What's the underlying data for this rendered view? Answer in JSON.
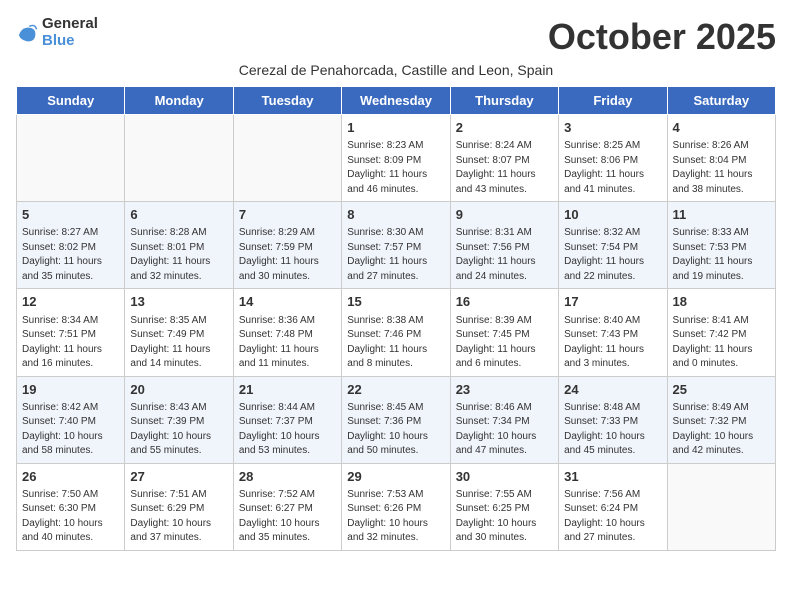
{
  "logo": {
    "general": "General",
    "blue": "Blue"
  },
  "title": "October 2025",
  "subtitle": "Cerezal de Penahorcada, Castille and Leon, Spain",
  "days_of_week": [
    "Sunday",
    "Monday",
    "Tuesday",
    "Wednesday",
    "Thursday",
    "Friday",
    "Saturday"
  ],
  "weeks": [
    [
      {
        "day": "",
        "info": ""
      },
      {
        "day": "",
        "info": ""
      },
      {
        "day": "",
        "info": ""
      },
      {
        "day": "1",
        "info": "Sunrise: 8:23 AM\nSunset: 8:09 PM\nDaylight: 11 hours and 46 minutes."
      },
      {
        "day": "2",
        "info": "Sunrise: 8:24 AM\nSunset: 8:07 PM\nDaylight: 11 hours and 43 minutes."
      },
      {
        "day": "3",
        "info": "Sunrise: 8:25 AM\nSunset: 8:06 PM\nDaylight: 11 hours and 41 minutes."
      },
      {
        "day": "4",
        "info": "Sunrise: 8:26 AM\nSunset: 8:04 PM\nDaylight: 11 hours and 38 minutes."
      }
    ],
    [
      {
        "day": "5",
        "info": "Sunrise: 8:27 AM\nSunset: 8:02 PM\nDaylight: 11 hours and 35 minutes."
      },
      {
        "day": "6",
        "info": "Sunrise: 8:28 AM\nSunset: 8:01 PM\nDaylight: 11 hours and 32 minutes."
      },
      {
        "day": "7",
        "info": "Sunrise: 8:29 AM\nSunset: 7:59 PM\nDaylight: 11 hours and 30 minutes."
      },
      {
        "day": "8",
        "info": "Sunrise: 8:30 AM\nSunset: 7:57 PM\nDaylight: 11 hours and 27 minutes."
      },
      {
        "day": "9",
        "info": "Sunrise: 8:31 AM\nSunset: 7:56 PM\nDaylight: 11 hours and 24 minutes."
      },
      {
        "day": "10",
        "info": "Sunrise: 8:32 AM\nSunset: 7:54 PM\nDaylight: 11 hours and 22 minutes."
      },
      {
        "day": "11",
        "info": "Sunrise: 8:33 AM\nSunset: 7:53 PM\nDaylight: 11 hours and 19 minutes."
      }
    ],
    [
      {
        "day": "12",
        "info": "Sunrise: 8:34 AM\nSunset: 7:51 PM\nDaylight: 11 hours and 16 minutes."
      },
      {
        "day": "13",
        "info": "Sunrise: 8:35 AM\nSunset: 7:49 PM\nDaylight: 11 hours and 14 minutes."
      },
      {
        "day": "14",
        "info": "Sunrise: 8:36 AM\nSunset: 7:48 PM\nDaylight: 11 hours and 11 minutes."
      },
      {
        "day": "15",
        "info": "Sunrise: 8:38 AM\nSunset: 7:46 PM\nDaylight: 11 hours and 8 minutes."
      },
      {
        "day": "16",
        "info": "Sunrise: 8:39 AM\nSunset: 7:45 PM\nDaylight: 11 hours and 6 minutes."
      },
      {
        "day": "17",
        "info": "Sunrise: 8:40 AM\nSunset: 7:43 PM\nDaylight: 11 hours and 3 minutes."
      },
      {
        "day": "18",
        "info": "Sunrise: 8:41 AM\nSunset: 7:42 PM\nDaylight: 11 hours and 0 minutes."
      }
    ],
    [
      {
        "day": "19",
        "info": "Sunrise: 8:42 AM\nSunset: 7:40 PM\nDaylight: 10 hours and 58 minutes."
      },
      {
        "day": "20",
        "info": "Sunrise: 8:43 AM\nSunset: 7:39 PM\nDaylight: 10 hours and 55 minutes."
      },
      {
        "day": "21",
        "info": "Sunrise: 8:44 AM\nSunset: 7:37 PM\nDaylight: 10 hours and 53 minutes."
      },
      {
        "day": "22",
        "info": "Sunrise: 8:45 AM\nSunset: 7:36 PM\nDaylight: 10 hours and 50 minutes."
      },
      {
        "day": "23",
        "info": "Sunrise: 8:46 AM\nSunset: 7:34 PM\nDaylight: 10 hours and 47 minutes."
      },
      {
        "day": "24",
        "info": "Sunrise: 8:48 AM\nSunset: 7:33 PM\nDaylight: 10 hours and 45 minutes."
      },
      {
        "day": "25",
        "info": "Sunrise: 8:49 AM\nSunset: 7:32 PM\nDaylight: 10 hours and 42 minutes."
      }
    ],
    [
      {
        "day": "26",
        "info": "Sunrise: 7:50 AM\nSunset: 6:30 PM\nDaylight: 10 hours and 40 minutes."
      },
      {
        "day": "27",
        "info": "Sunrise: 7:51 AM\nSunset: 6:29 PM\nDaylight: 10 hours and 37 minutes."
      },
      {
        "day": "28",
        "info": "Sunrise: 7:52 AM\nSunset: 6:27 PM\nDaylight: 10 hours and 35 minutes."
      },
      {
        "day": "29",
        "info": "Sunrise: 7:53 AM\nSunset: 6:26 PM\nDaylight: 10 hours and 32 minutes."
      },
      {
        "day": "30",
        "info": "Sunrise: 7:55 AM\nSunset: 6:25 PM\nDaylight: 10 hours and 30 minutes."
      },
      {
        "day": "31",
        "info": "Sunrise: 7:56 AM\nSunset: 6:24 PM\nDaylight: 10 hours and 27 minutes."
      },
      {
        "day": "",
        "info": ""
      }
    ]
  ],
  "row_classes": [
    "row-white",
    "row-shaded",
    "row-white",
    "row-shaded",
    "row-white"
  ]
}
